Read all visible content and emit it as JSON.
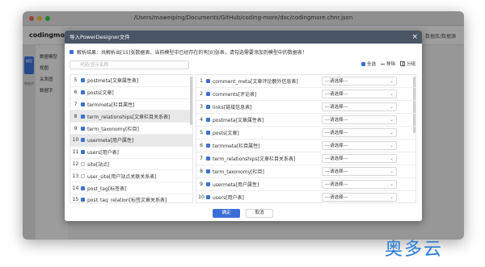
{
  "window": {
    "title": "/Users/maweiping/Documents/GitHub/coding-more/doc/codingmore.chnr.json"
  },
  "app": {
    "name": "codingmo",
    "header_right": "数据库/数据源",
    "sidebar": [
      {
        "label": "模型"
      },
      {
        "label": "数据库"
      }
    ],
    "tree": [
      "数据模型",
      "视图",
      "关系图",
      "数据字"
    ]
  },
  "dialog": {
    "title": "导入PowerDesigner文件",
    "close": "×",
    "info": "解析结果：共解析出[15]张数据表，当前模型中已经存在的有[0]张表，请勾选需要添加到模型中的数据表！",
    "search_placeholder": "代码/显示名称",
    "tools": {
      "select_all": "全选",
      "remove": "移除",
      "group": "分组"
    },
    "tables": [
      {
        "num": "5",
        "label": "postmeta[文章属性表]",
        "checked": true
      },
      {
        "num": "6",
        "label": "posts[文章]",
        "checked": true
      },
      {
        "num": "7",
        "label": "termmeta[栏目属性]",
        "checked": true
      },
      {
        "num": "8",
        "label": "term_relationships[文章栏目关系表]",
        "checked": true,
        "selected": true
      },
      {
        "num": "9",
        "label": "term_taxonomy[栏目]",
        "checked": true
      },
      {
        "num": "10",
        "label": "usermeta[用户属性]",
        "checked": true,
        "selected": true
      },
      {
        "num": "11",
        "label": "users[用户表]",
        "checked": true
      },
      {
        "num": "12",
        "label": "site[站点]",
        "checked": false
      },
      {
        "num": "13",
        "label": "user_site[用户站点关联关系表]",
        "checked": false
      },
      {
        "num": "14",
        "label": "post_tag[标签表]",
        "checked": true
      },
      {
        "num": "15",
        "label": "post_tag_relation[标签文章关系表]",
        "checked": true
      }
    ],
    "mapping": [
      {
        "num": "1",
        "label": "comment_meta[文章评论额外信息表]",
        "select": "---请选择---"
      },
      {
        "num": "2",
        "label": "comments[评论表]",
        "select": "---请选择---"
      },
      {
        "num": "3",
        "label": "links[链接信息表]",
        "select": "---请选择---"
      },
      {
        "num": "4",
        "label": "postmeta[文章属性表]",
        "select": "---请选择---"
      },
      {
        "num": "5",
        "label": "posts[文章]",
        "select": "---请选择---"
      },
      {
        "num": "6",
        "label": "termmeta[栏目属性]",
        "select": "---请选择---"
      },
      {
        "num": "7",
        "label": "term_relationships[文章栏目关系表]",
        "select": "---请选择---"
      },
      {
        "num": "8",
        "label": "term_taxonomy[栏目]",
        "select": "---请选择---"
      },
      {
        "num": "9",
        "label": "usermeta[用户属性]",
        "select": "---请选择---"
      },
      {
        "num": "10",
        "label": "users[用户表]",
        "select": "---请选择---"
      }
    ],
    "ok": "确定",
    "cancel": "取消"
  },
  "watermark": "奥多云",
  "colors": {
    "accent": "#3b6fd6",
    "dialog_title_bg": "#4a5566"
  }
}
